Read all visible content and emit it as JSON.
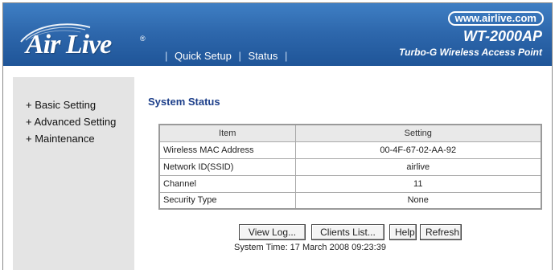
{
  "header": {
    "logo": "Air Live",
    "logo_reg": "®",
    "url": "www.airlive.com",
    "model": "WT-2000AP",
    "tagline": "Turbo-G Wireless Access Point",
    "nav": [
      {
        "label": "Quick Setup"
      },
      {
        "label": "Status"
      }
    ],
    "brand_color": "#2e68ad"
  },
  "sidebar": {
    "items": [
      {
        "label": "+ Basic Setting"
      },
      {
        "label": "+ Advanced Setting"
      },
      {
        "label": "+ Maintenance"
      }
    ]
  },
  "main": {
    "title": "System Status",
    "table": {
      "headers": [
        "Item",
        "Setting"
      ],
      "rows": [
        [
          "Wireless MAC Address",
          "00-4F-67-02-AA-92"
        ],
        [
          "Network ID(SSID)",
          "airlive"
        ],
        [
          "Channel",
          "11"
        ],
        [
          "Security Type",
          "None"
        ]
      ]
    },
    "buttons": {
      "view_log": "View Log...",
      "clients_list": "Clients List...",
      "help": "Help",
      "refresh": "Refresh"
    },
    "system_time": "System Time: 17 March 2008 09:23:39"
  }
}
